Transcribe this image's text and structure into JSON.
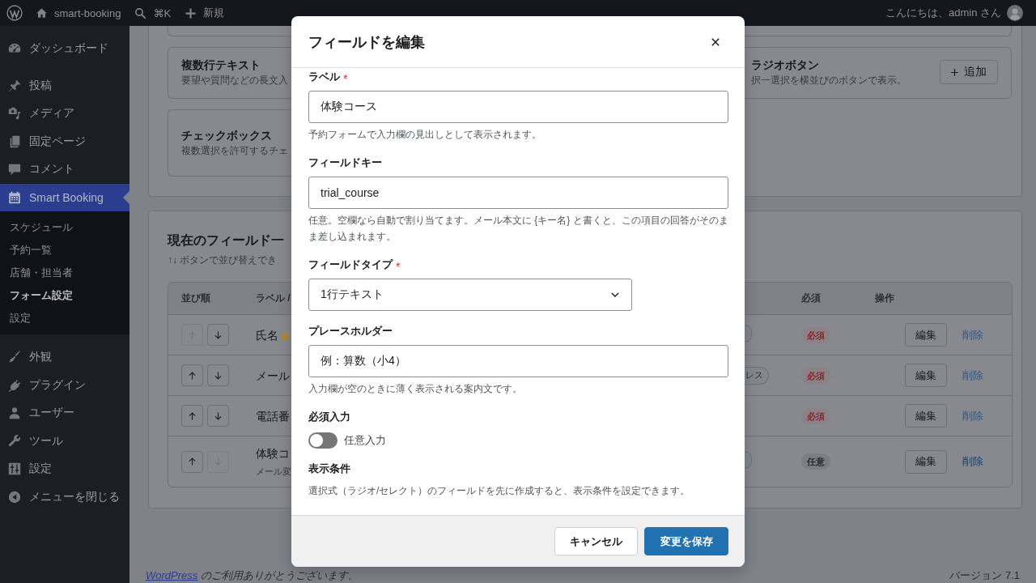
{
  "admin_bar": {
    "site": "smart-booking",
    "shortcut": "⌘K",
    "new": "新規",
    "greeting": "こんにちは、admin さん"
  },
  "sidebar": {
    "sections": [
      {
        "items": [
          {
            "label": "ダッシュボード",
            "selected": false
          }
        ]
      },
      {
        "items": [
          {
            "label": "投稿",
            "selected": false
          },
          {
            "label": "メディア",
            "selected": false
          },
          {
            "label": "固定ページ",
            "selected": false
          },
          {
            "label": "コメント",
            "selected": false
          },
          {
            "label": "Smart Booking",
            "selected": true,
            "submenu": [
              {
                "label": "スケジュール",
                "selected": false
              },
              {
                "label": "予約一覧",
                "selected": false
              },
              {
                "label": "店舗・担当者",
                "selected": false
              },
              {
                "label": "フォーム設定",
                "selected": true
              },
              {
                "label": "設定",
                "selected": false
              }
            ]
          }
        ]
      },
      {
        "items": [
          {
            "label": "外観",
            "selected": false
          },
          {
            "label": "プラグイン",
            "selected": false
          },
          {
            "label": "ユーザー",
            "selected": false
          },
          {
            "label": "ツール",
            "selected": false
          },
          {
            "label": "設定",
            "selected": false
          }
        ]
      }
    ],
    "collapse": "メニューを閉じる"
  },
  "field_types": {
    "rows": [
      {
        "left": {
          "title": "複数行テキスト",
          "description": "要望や質問などの長文入"
        },
        "right": {
          "title": "ラジオボタン",
          "description": "択一選択を横並びのボタンで表示。",
          "add_button": "追加"
        }
      },
      {
        "left": {
          "title": "チェックボックス",
          "description": "複数選択を許可するチェ"
        }
      }
    ]
  },
  "field_list": {
    "title": "現在のフィールド一",
    "subtitle": "↑↓ ボタンで並び替えでき",
    "columns": {
      "order": "並び順",
      "label": "ラベル /",
      "required": "必須",
      "actions": "操作"
    },
    "rows": [
      {
        "up_disabled": true,
        "down_disabled": false,
        "label": "氏名",
        "locked": true,
        "tag_shown": true,
        "required": true,
        "required_label": "必須",
        "edit": "編集",
        "delete": "削除",
        "delete_disabled": true
      },
      {
        "up_disabled": false,
        "down_disabled": false,
        "label": "メール",
        "locked": false,
        "tag_shown": true,
        "tag": "レス",
        "required": true,
        "required_label": "必須",
        "edit": "編集",
        "delete": "削除",
        "delete_disabled": true
      },
      {
        "up_disabled": false,
        "down_disabled": false,
        "label": "電話番",
        "locked": false,
        "tag_shown": false,
        "required": true,
        "required_label": "必須",
        "edit": "編集",
        "delete": "削除",
        "delete_disabled": true
      },
      {
        "up_disabled": false,
        "down_disabled": true,
        "label": "体験コ",
        "note": "メール変",
        "locked": false,
        "tag_shown": true,
        "required": false,
        "required_label": "任意",
        "edit": "編集",
        "delete": "削除",
        "delete_disabled": false
      }
    ]
  },
  "footer": {
    "link": "WordPress",
    "thanks": "のご利用ありがとうございます。",
    "version": "バージョン 7.1"
  },
  "modal": {
    "title": "フィールドを編集",
    "fields": [
      {
        "kind": "text",
        "label": "ラベル",
        "required": true,
        "value": "体験コース",
        "help": "予約フォームで入力欄の見出しとして表示されます。"
      },
      {
        "kind": "text",
        "label": "フィールドキー",
        "required": false,
        "value": "trial_course",
        "help": "任意。空欄なら自動で割り当てます。メール本文に {キー名} と書くと、この項目の回答がそのまま差し込まれます。"
      },
      {
        "kind": "select",
        "label": "フィールドタイプ",
        "required": true,
        "value": "1行テキスト"
      },
      {
        "kind": "text",
        "label": "プレースホルダー",
        "required": false,
        "value": "例：算数（小4）",
        "help": "入力欄が空のときに薄く表示される案内文です。"
      },
      {
        "kind": "toggle",
        "label": "必須入力",
        "required": false,
        "on": false,
        "toggle_label": "任意入力"
      },
      {
        "kind": "note",
        "label": "表示条件",
        "required": false,
        "help": "選択式（ラジオ/セレクト）のフィールドを先に作成すると、表示条件を設定できます。"
      }
    ],
    "buttons": [
      {
        "label": "キャンセル",
        "kind": "secondary"
      },
      {
        "label": "変更を保存",
        "kind": "primary"
      }
    ]
  }
}
